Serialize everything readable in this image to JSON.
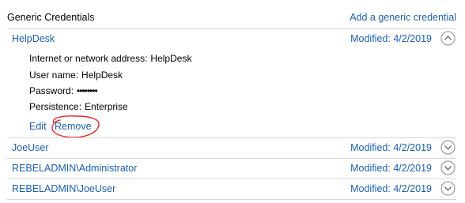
{
  "header": {
    "title": "Generic Credentials",
    "add_link": "Add a generic credential"
  },
  "credentials": [
    {
      "name": "HelpDesk",
      "modified_label": "Modified:",
      "modified_date": "4/2/2019",
      "expanded": true,
      "details": {
        "address_label": "Internet or network address:",
        "address_value": "HelpDesk",
        "username_label": "User name:",
        "username_value": "HelpDesk",
        "password_label": "Password:",
        "password_value": "••••••••",
        "persistence_label": "Persistence:",
        "persistence_value": "Enterprise"
      },
      "actions": {
        "edit": "Edit",
        "remove": "Remove"
      }
    },
    {
      "name": "JoeUser",
      "modified_label": "Modified:",
      "modified_date": "4/2/2019",
      "expanded": false
    },
    {
      "name": "REBELADMIN\\Administrator",
      "modified_label": "Modified:",
      "modified_date": "4/2/2019",
      "expanded": false
    },
    {
      "name": "REBELADMIN\\JoeUser",
      "modified_label": "Modified:",
      "modified_date": "4/2/2019",
      "expanded": false
    }
  ],
  "icons": {
    "collapse": "chevron-up-icon",
    "expand": "chevron-down-icon"
  },
  "colors": {
    "link": "#1a5fb4",
    "annotation": "#e8262a",
    "divider": "#d6d6d6"
  }
}
